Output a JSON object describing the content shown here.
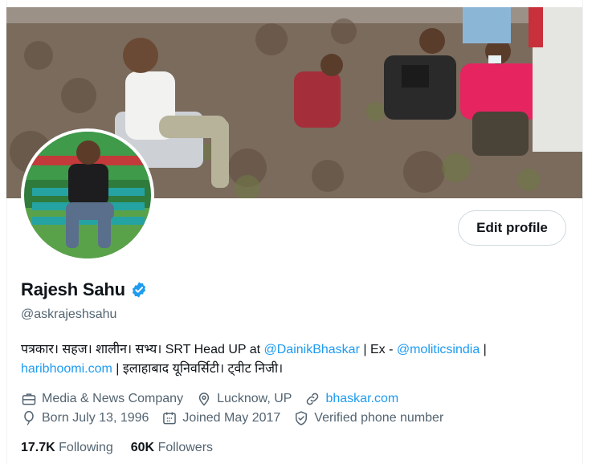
{
  "profile": {
    "name": "Rajesh Sahu",
    "handle": "@askrajeshsahu",
    "edit_label": "Edit profile"
  },
  "bio": {
    "p1": "पत्रकार। सहज। शालीन। सभ्य। SRT Head UP at ",
    "m1": "@DainikBhaskar",
    "p2": " | Ex - ",
    "m2": "@moliticsindia",
    "p3": " |",
    "link": "haribhoomi.com",
    "p4": " | इलाहाबाद यूनिवर्सिटी। ट्वीट निजी।"
  },
  "meta": {
    "category": "Media & News Company",
    "location": "Lucknow, UP",
    "website": "bhaskar.com",
    "born": "Born July 13, 1996",
    "joined": "Joined May 2017",
    "verified_phone": "Verified phone number"
  },
  "stats": {
    "following_count": "17.7K",
    "following_label": "Following",
    "followers_count": "60K",
    "followers_label": "Followers"
  },
  "colors": {
    "accent": "#1d9bf0",
    "muted": "#536471",
    "text": "#0f1419"
  },
  "icons": [
    "briefcase-icon",
    "location-pin-icon",
    "link-icon",
    "birthday-balloon-icon",
    "calendar-icon",
    "verified-shield-icon",
    "verified-badge-icon"
  ]
}
